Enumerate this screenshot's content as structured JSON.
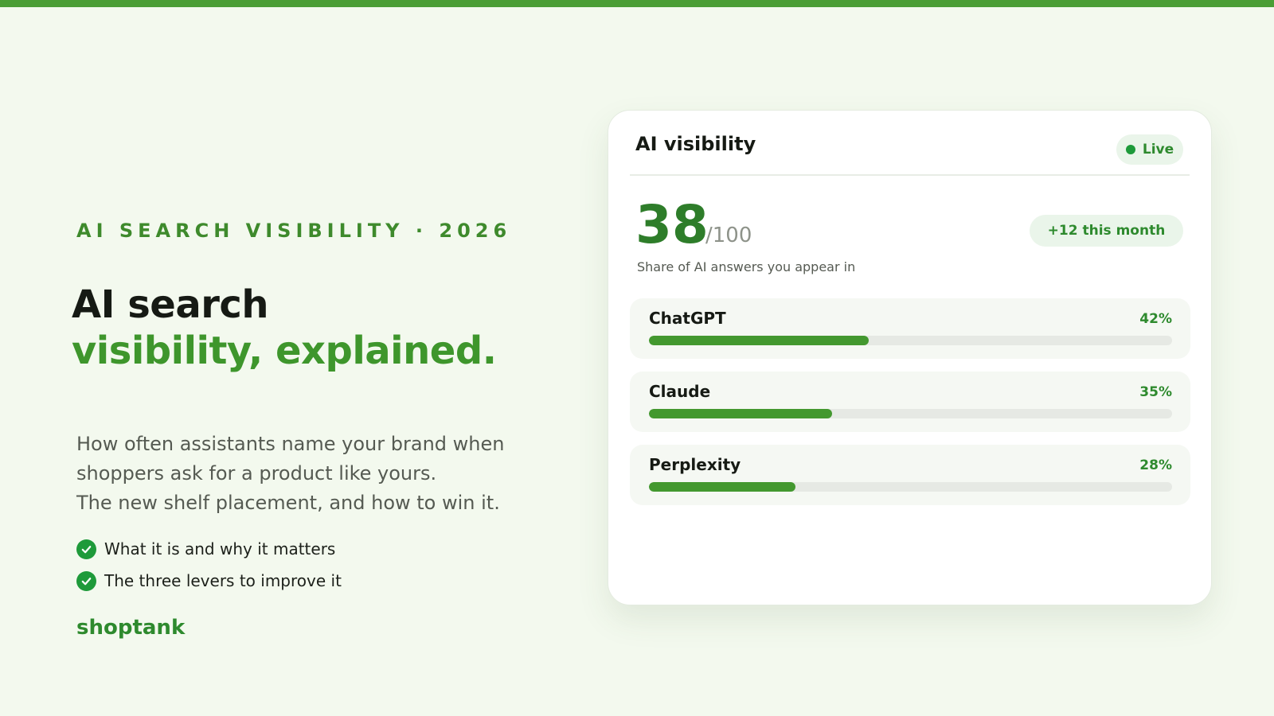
{
  "colors": {
    "accent": "#4a9e35",
    "headline_accent": "#3e962c",
    "background": "#f3f9ee",
    "check": "#1e9a3a",
    "bar_fill": "#43982f",
    "bar_track": "#e6e9e4"
  },
  "hero": {
    "eyebrow": "AI SEARCH VISIBILITY · 2026",
    "headline_line1": "AI search",
    "headline_line2": "visibility, explained.",
    "description_lines": [
      "How often assistants name your brand when",
      "shoppers ask for a product like yours.",
      "The new shelf placement, and how to win it."
    ],
    "checklist": [
      {
        "icon": "check-circle-icon",
        "label": "What it is and why it matters"
      },
      {
        "icon": "check-circle-icon",
        "label": "The three levers to improve it"
      }
    ],
    "brand": "shoptank"
  },
  "card": {
    "title": "AI visibility",
    "status": {
      "icon": "live-dot-icon",
      "label": "Live"
    },
    "score": {
      "value": "38",
      "max": "/100",
      "caption": "Share of AI answers you appear in",
      "trend": "+12 this month"
    },
    "platforms": [
      {
        "name": "ChatGPT",
        "percent_label": "42%",
        "value": 0.42
      },
      {
        "name": "Claude",
        "percent_label": "35%",
        "value": 0.35
      },
      {
        "name": "Perplexity",
        "percent_label": "28%",
        "value": 0.28
      }
    ]
  }
}
